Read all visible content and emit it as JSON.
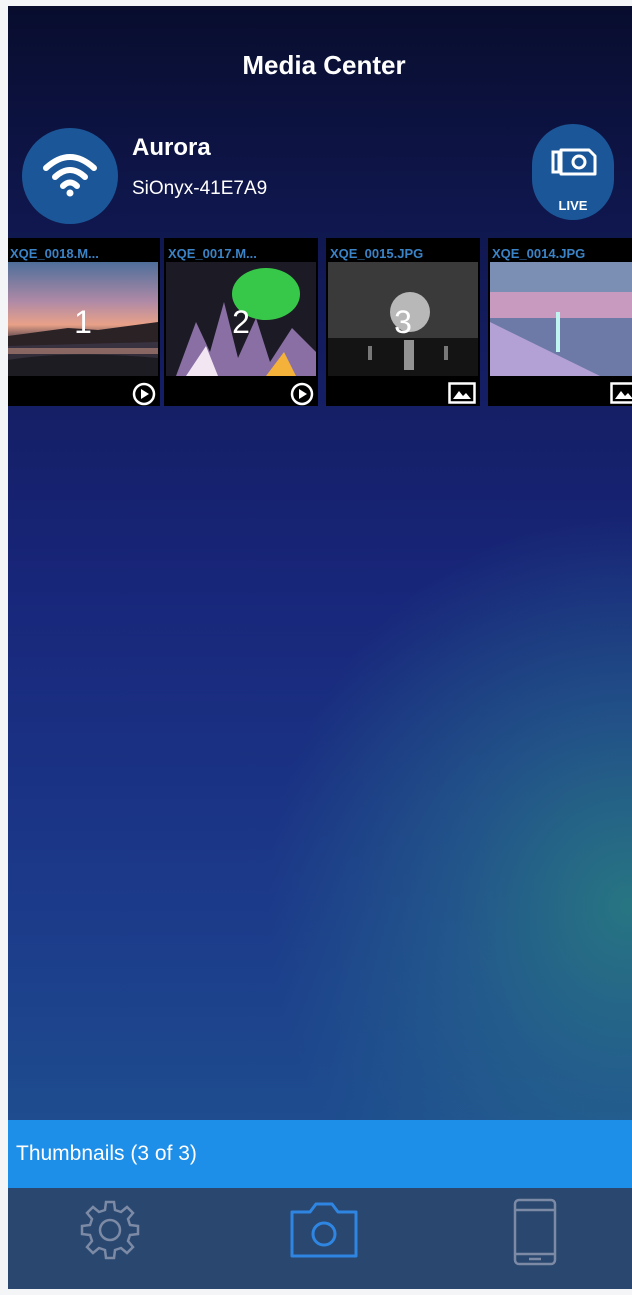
{
  "header": {
    "title": "Media Center"
  },
  "device": {
    "name": "Aurora",
    "ssid": "SiOnyx-41E7A9"
  },
  "live": {
    "label": "LIVE"
  },
  "thumbnails": [
    {
      "name": "XQE_0018.M...",
      "number": "1",
      "type": "video"
    },
    {
      "name": "XQE_0017.M...",
      "number": "2",
      "type": "video"
    },
    {
      "name": "XQE_0015.JPG",
      "number": "3",
      "type": "image"
    },
    {
      "name": "XQE_0014.JPG",
      "number": "",
      "type": "image"
    }
  ],
  "status": {
    "label": "Thumbnails (3 of 3)"
  },
  "tabs": [
    {
      "name": "settings",
      "icon": "gear-icon"
    },
    {
      "name": "camera",
      "icon": "camera-icon",
      "active": true
    },
    {
      "name": "device",
      "icon": "phone-icon"
    }
  ],
  "colors": {
    "accent": "#1e8fe8",
    "active_tab": "#2f86e2",
    "inactive_tab": "#7c8aa6"
  }
}
